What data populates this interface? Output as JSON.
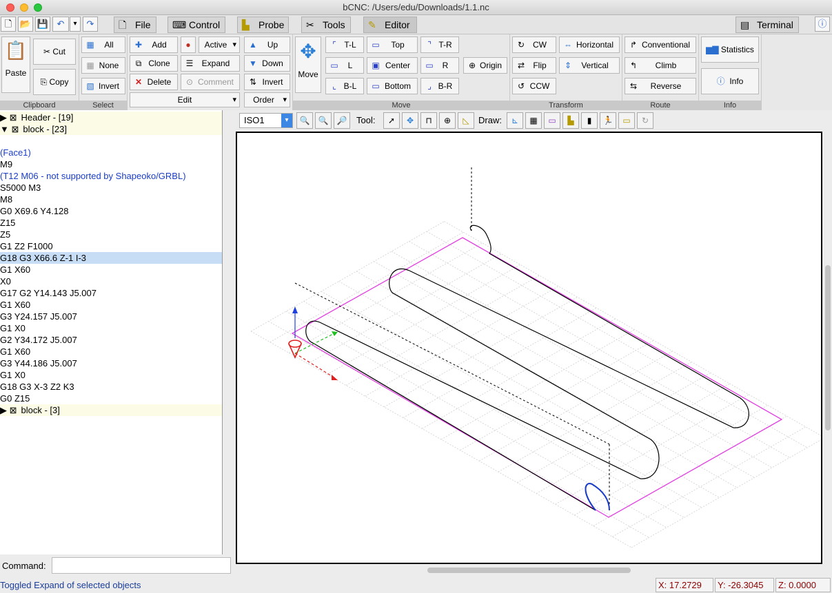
{
  "window": {
    "title": "bCNC: /Users/edu/Downloads/1.1.nc"
  },
  "tabs": [
    {
      "label": "File",
      "icon": "file-icon"
    },
    {
      "label": "Control",
      "icon": "control-icon"
    },
    {
      "label": "Probe",
      "icon": "probe-icon"
    },
    {
      "label": "Tools",
      "icon": "tools-icon"
    },
    {
      "label": "Editor",
      "icon": "editor-icon"
    }
  ],
  "terminal": {
    "label": "Terminal"
  },
  "ribbon": {
    "clipboard": {
      "label": "Clipboard",
      "paste": "Paste",
      "cut": "Cut",
      "copy": "Copy"
    },
    "select": {
      "label": "Select",
      "all": "All",
      "none": "None",
      "invert": "Invert"
    },
    "edit": {
      "label": "Edit",
      "add": "Add",
      "clone": "Clone",
      "delete": "Delete",
      "active": "Active",
      "expand": "Expand",
      "comment": "Comment",
      "up": "Up",
      "down": "Down",
      "invert": "Invert",
      "order": "Order"
    },
    "move": {
      "label": "Move",
      "move": "Move",
      "tl": "T-L",
      "l": "L",
      "bl": "B-L",
      "top": "Top",
      "center": "Center",
      "bottom": "Bottom",
      "tr": "T-R",
      "r": "R",
      "br": "B-R",
      "origin": "Origin"
    },
    "transform": {
      "label": "Transform",
      "cw": "CW",
      "flip": "Flip",
      "ccw": "CCW",
      "horizontal": "Horizontal",
      "vertical": "Vertical"
    },
    "route": {
      "label": "Route",
      "conventional": "Conventional",
      "climb": "Climb",
      "reverse": "Reverse"
    },
    "info": {
      "label": "Info",
      "statistics": "Statistics",
      "info": "Info"
    }
  },
  "gcode": [
    {
      "text": "Header - [19]",
      "kind": "hdr",
      "marker": "▶ ⊠"
    },
    {
      "text": "block - [23]",
      "kind": "hdr",
      "marker": "▼ ⊠"
    },
    {
      "text": "",
      "kind": "blank"
    },
    {
      "text": "(Face1)",
      "kind": "cmt"
    },
    {
      "text": "M9",
      "kind": "code"
    },
    {
      "text": "(T12 M06 - not supported by Shapeoko/GRBL)",
      "kind": "cmt"
    },
    {
      "text": "S5000 M3",
      "kind": "code"
    },
    {
      "text": "M8",
      "kind": "code"
    },
    {
      "text": "G0 X69.6 Y4.128",
      "kind": "code"
    },
    {
      "text": "Z15",
      "kind": "code"
    },
    {
      "text": "Z5",
      "kind": "code"
    },
    {
      "text": "G1 Z2 F1000",
      "kind": "code"
    },
    {
      "text": "G18 G3 X66.6 Z-1 I-3",
      "kind": "sel"
    },
    {
      "text": "G1 X60",
      "kind": "code"
    },
    {
      "text": "X0",
      "kind": "code"
    },
    {
      "text": "G17 G2 Y14.143 J5.007",
      "kind": "code"
    },
    {
      "text": "G1 X60",
      "kind": "code"
    },
    {
      "text": "G3 Y24.157 J5.007",
      "kind": "code"
    },
    {
      "text": "G1 X0",
      "kind": "code"
    },
    {
      "text": "G2 Y34.172 J5.007",
      "kind": "code"
    },
    {
      "text": "G1 X60",
      "kind": "code"
    },
    {
      "text": "G3 Y44.186 J5.007",
      "kind": "code"
    },
    {
      "text": "G1 X0",
      "kind": "code"
    },
    {
      "text": "G18 G3 X-3 Z2 K3",
      "kind": "code"
    },
    {
      "text": "G0 Z15",
      "kind": "code"
    },
    {
      "text": "block - [3]",
      "kind": "hdr",
      "marker": "▶ ⊠"
    }
  ],
  "command": {
    "label": "Command:"
  },
  "view": {
    "mode": "ISO1",
    "tool_label": "Tool:",
    "draw_label": "Draw:"
  },
  "status": {
    "message": "Toggled Expand of selected objects",
    "x": "X: 17.2729",
    "y": "Y: -26.3045",
    "z": "Z: 0.0000"
  },
  "colors": {
    "margin": "#e040e0",
    "path": "#000000",
    "selected_path": "#1a3cc8",
    "tool": "#e02020"
  }
}
